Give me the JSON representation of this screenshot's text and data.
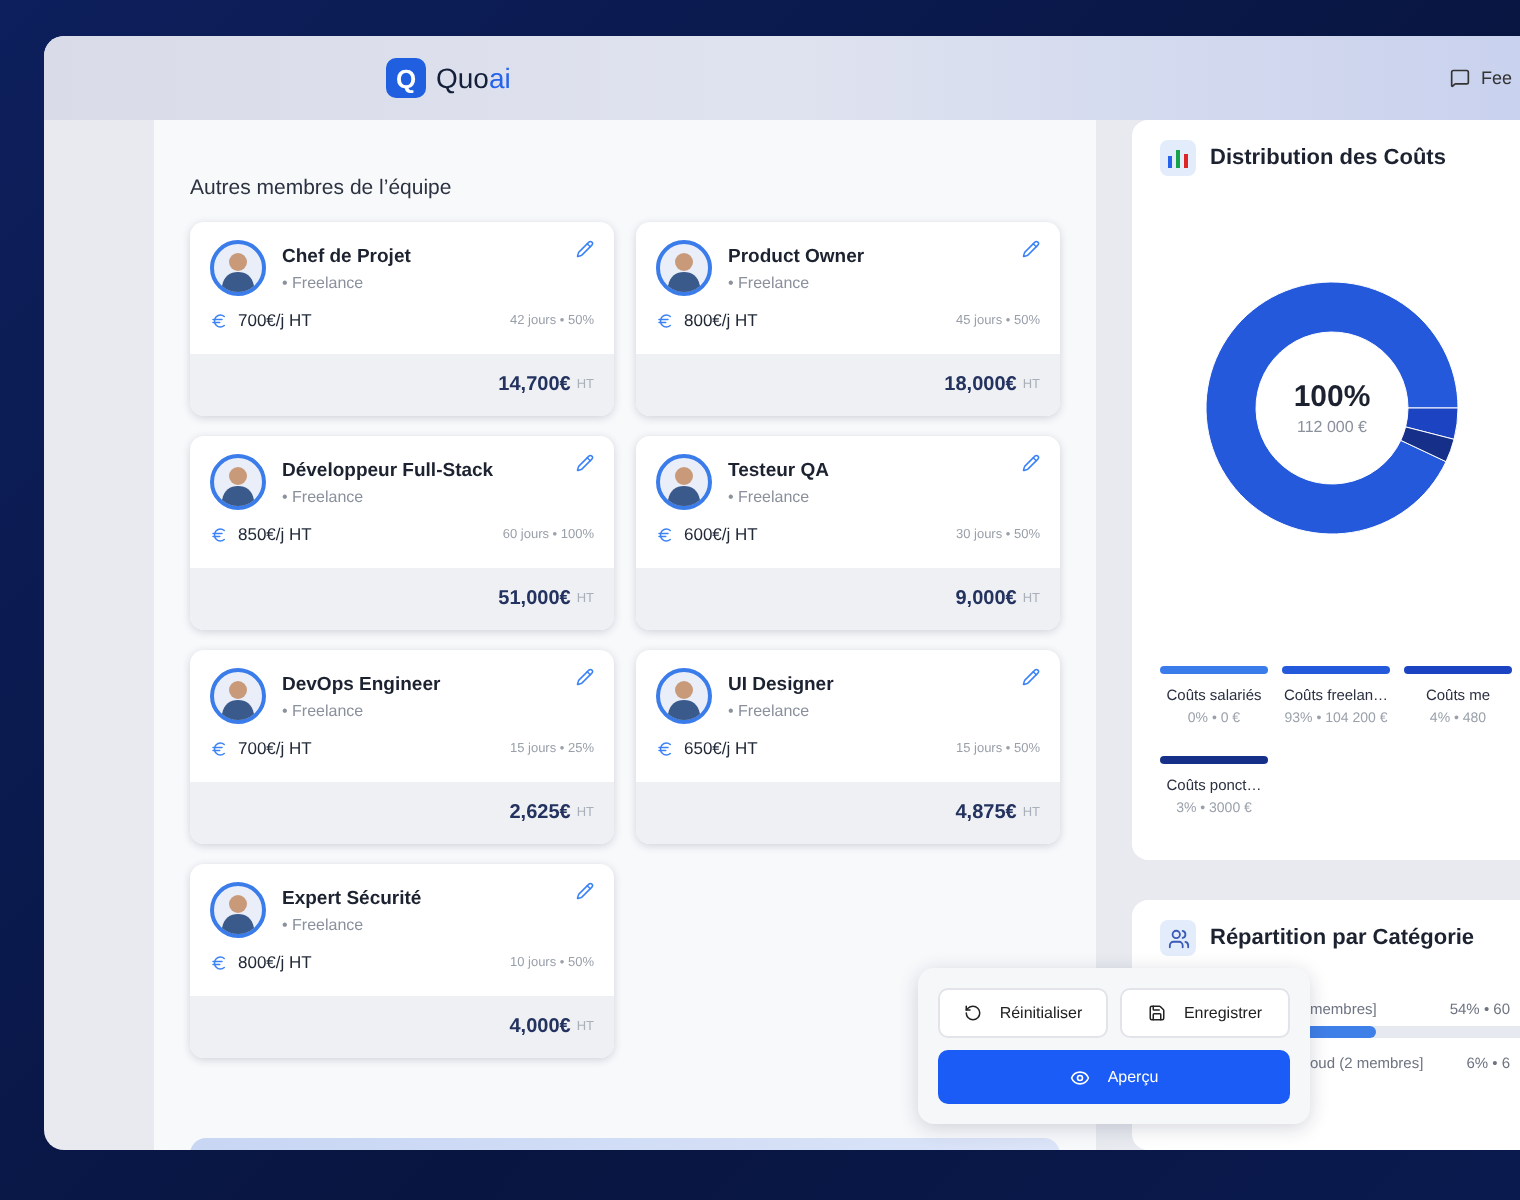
{
  "header": {
    "logo_letter": "Q",
    "logo_main": "Quo",
    "logo_accent": "ai",
    "feedback": "Fee"
  },
  "team": {
    "title": "Autres membres de l’équipe",
    "members": [
      {
        "role": "Chef de Projet",
        "type": "• Freelance",
        "rate": "700€/j HT",
        "detail": "42 jours • 50%",
        "total": "14,700€",
        "unit": "HT"
      },
      {
        "role": "Product Owner",
        "type": "• Freelance",
        "rate": "800€/j HT",
        "detail": "45 jours • 50%",
        "total": "18,000€",
        "unit": "HT"
      },
      {
        "role": "Développeur Full-Stack",
        "type": "• Freelance",
        "rate": "850€/j HT",
        "detail": "60 jours • 100%",
        "total": "51,000€",
        "unit": "HT"
      },
      {
        "role": "Testeur QA",
        "type": "• Freelance",
        "rate": "600€/j HT",
        "detail": "30 jours • 50%",
        "total": "9,000€",
        "unit": "HT"
      },
      {
        "role": "DevOps Engineer",
        "type": "• Freelance",
        "rate": "700€/j HT",
        "detail": "15 jours • 25%",
        "total": "2,625€",
        "unit": "HT"
      },
      {
        "role": "UI Designer",
        "type": "• Freelance",
        "rate": "650€/j HT",
        "detail": "15 jours • 50%",
        "total": "4,875€",
        "unit": "HT"
      },
      {
        "role": "Expert Sécurité",
        "type": "• Freelance",
        "rate": "800€/j HT",
        "detail": "10 jours • 50%",
        "total": "4,000€",
        "unit": "HT"
      }
    ]
  },
  "distribution": {
    "title": "Distribution des Coûts",
    "center_value": "100%",
    "center_sub": "112 000 €",
    "chart_data": {
      "type": "donut",
      "categories": [
        "Coûts salariés",
        "Coûts freelan…",
        "Coûts me",
        "Coûts ponct…"
      ],
      "values": [
        0,
        93,
        4,
        3
      ]
    },
    "legend": [
      {
        "reading": "0% • 0 €",
        "color": "#3b7ceb"
      },
      {
        "reading": "93% • 104 200 €",
        "color": "#2459db"
      },
      {
        "reading": "4% • 480",
        "color": "#1c44c2"
      },
      {
        "reading": "3% • 3000 €",
        "color": "#16308a"
      }
    ]
  },
  "categories": {
    "title": "Répartition par Catégorie",
    "rows": [
      {
        "label": "membres]",
        "reading": "54% • 60",
        "level": 0.54
      },
      {
        "label": "oud (2 membres]",
        "reading": "6% • 6"
      }
    ]
  },
  "actions": [
    {
      "kind": "reset",
      "label": "Réinitialiser"
    },
    {
      "kind": "save",
      "label": "Enregistrer"
    },
    {
      "kind": "preview",
      "label": "Aperçu"
    }
  ]
}
